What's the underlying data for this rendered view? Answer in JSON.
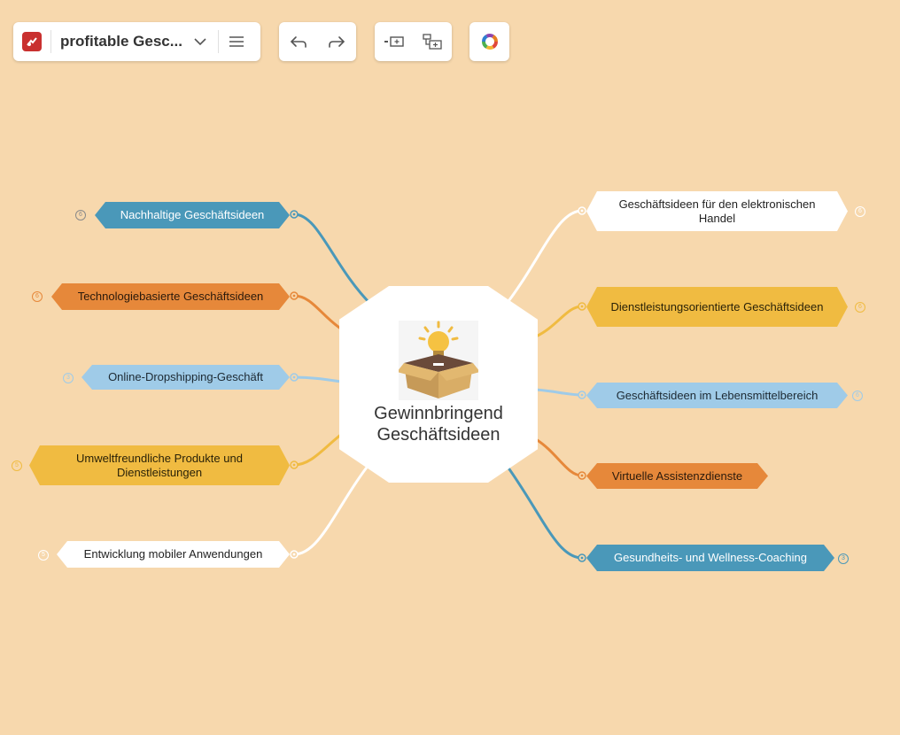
{
  "toolbar": {
    "doc_title": "profitable Gesc...",
    "icons": [
      "app-logo-icon",
      "chevron-down-icon",
      "menu-icon",
      "undo-icon",
      "redo-icon",
      "insert-sibling-icon",
      "insert-child-icon",
      "theme-color-icon"
    ]
  },
  "mindmap": {
    "root": "Gewinnbringend Geschäftsideen",
    "left": [
      {
        "label": "Nachhaltige Geschäftsideen",
        "color": "blue",
        "count": "6"
      },
      {
        "label": "Technologiebasierte Geschäftsideen",
        "color": "orange",
        "count": "6"
      },
      {
        "label": "Online-Dropshipping-Geschäft",
        "color": "lightblue",
        "count": "3"
      },
      {
        "label": "Umweltfreundliche Produkte und Dienstleistungen",
        "color": "yellow",
        "count": "5"
      },
      {
        "label": "Entwicklung mobiler Anwendungen",
        "color": "white",
        "count": "5"
      }
    ],
    "right": [
      {
        "label": "Geschäftsideen für den elektronischen Handel",
        "color": "white",
        "count": "6"
      },
      {
        "label": "Dienstleistungsorientierte Geschäftsideen",
        "color": "yellow",
        "count": "6"
      },
      {
        "label": "Geschäftsideen im Lebensmittelbereich",
        "color": "lightblue",
        "count": "6"
      },
      {
        "label": "Virtuelle Assistenzdienste",
        "color": "orange",
        "count": ""
      },
      {
        "label": "Gesundheits- und Wellness-Coaching",
        "color": "blue",
        "count": "3"
      }
    ]
  },
  "colors": {
    "background": "#f7d8ad",
    "blue": "#4a98b9",
    "orange": "#e6883a",
    "yellow": "#f0bb41",
    "lightblue": "#9fcbe8",
    "white": "#ffffff"
  }
}
